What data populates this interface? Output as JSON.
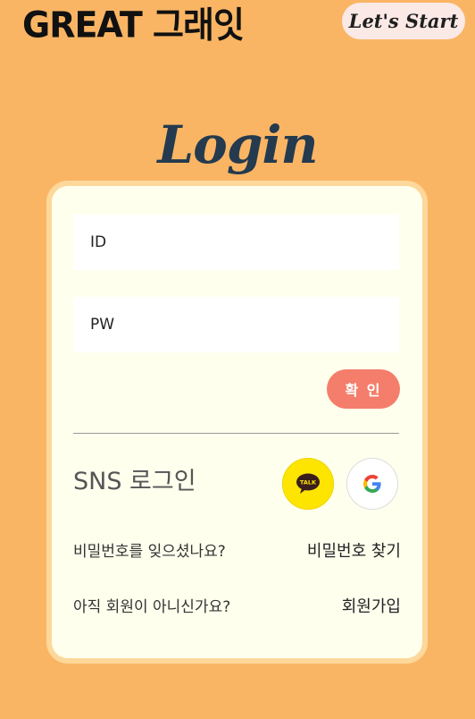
{
  "header": {
    "logo_text": "GREAT 그래잇",
    "start_button": "Let's Start"
  },
  "login": {
    "title": "Login",
    "id_placeholder": "ID",
    "pw_placeholder": "PW",
    "confirm_label": "확 인",
    "sns_label": "SNS 로그인",
    "kakao_icon_text": "TALK",
    "forgot_question": "비밀번호를 잊으셨나요?",
    "forgot_link": "비밀번호 찾기",
    "signup_question": "아직 회원이 아니신가요?",
    "signup_link": "회원가입"
  },
  "colors": {
    "background": "#FAB564",
    "card": "#FFFFEE",
    "card_border": "#FDD89A",
    "title": "#243A4E",
    "confirm": "#F47E6B",
    "kakao": "#FEE500"
  },
  "icons": [
    "kakao-talk-icon",
    "google-icon"
  ]
}
